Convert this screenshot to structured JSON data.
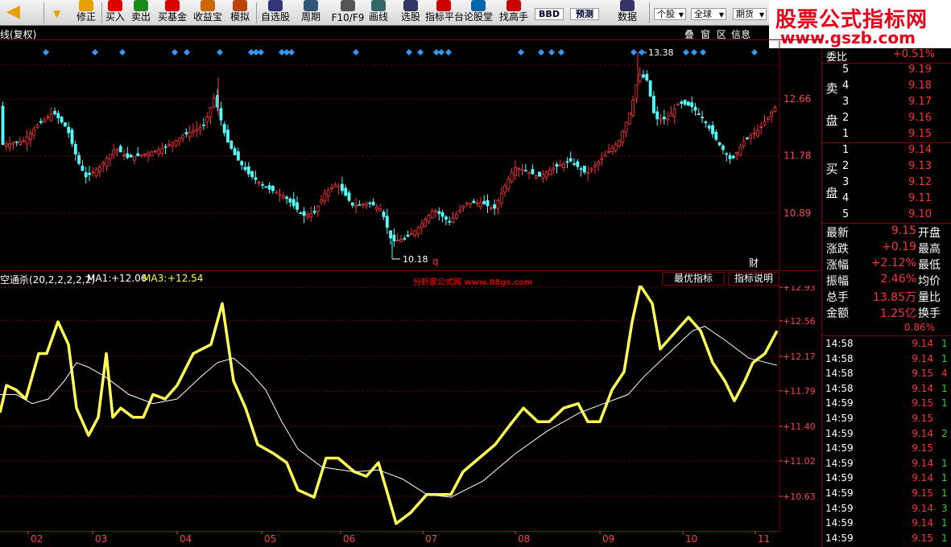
{
  "toolbar": {
    "buttons": [
      "修正",
      "买入",
      "卖出",
      "买基金",
      "收益宝",
      "模拟",
      "自选股",
      "周期",
      "F10/F9",
      "画线",
      "选股",
      "指标平台",
      "论股堂",
      "找高手",
      "数据"
    ],
    "badges": [
      "BBD",
      "预测"
    ],
    "dropdowns": [
      "个股",
      "全球",
      "期货"
    ]
  },
  "watermark": {
    "line1": "股票公式指标网",
    "line2": "www.gszb.com"
  },
  "chart": {
    "title": "线(复权)",
    "header_icons": [
      "叠",
      "窗",
      "区",
      "信息"
    ],
    "price_high_label": "13.38",
    "price_low_label": "10.18",
    "marker_q": "q",
    "marker_cai": "财",
    "price_axis": [
      "12.66",
      "11.78",
      "10.89"
    ]
  },
  "indicator": {
    "name": "空通杀(20,2,2,2,2,2)",
    "ma1_label": "MA1:",
    "ma1_value": "+12.06",
    "ma3_label": "MA3:",
    "ma3_value": "+12.54",
    "watermark_text": "分析家公式网 www.88gs.com",
    "buttons": [
      "最优指标",
      "指标说明"
    ],
    "axis": [
      "+12.93",
      "+12.56",
      "+12.17",
      "+11.79",
      "+11.40",
      "+11.02",
      "+10.63"
    ],
    "months": [
      "02",
      "03",
      "04",
      "05",
      "06",
      "07",
      "08",
      "09",
      "10",
      "11"
    ]
  },
  "quote": {
    "weibi_label": "委比",
    "weibi_value": "+0.51%",
    "sell_label": [
      "卖",
      "盘"
    ],
    "buy_label": [
      "买",
      "盘"
    ],
    "sell": [
      {
        "level": "5",
        "price": "9.19"
      },
      {
        "level": "4",
        "price": "9.18"
      },
      {
        "level": "3",
        "price": "9.17"
      },
      {
        "level": "2",
        "price": "9.16"
      },
      {
        "level": "1",
        "price": "9.15"
      }
    ],
    "buy": [
      {
        "level": "1",
        "price": "9.14"
      },
      {
        "level": "2",
        "price": "9.13"
      },
      {
        "level": "3",
        "price": "9.12"
      },
      {
        "level": "4",
        "price": "9.11"
      },
      {
        "level": "5",
        "price": "9.10"
      }
    ],
    "stats": [
      {
        "label": "最新",
        "value": "9.15",
        "right": "开盘"
      },
      {
        "label": "涨跌",
        "value": "+0.19",
        "right": "最高"
      },
      {
        "label": "涨幅",
        "value": "+2.12%",
        "right": "最低"
      },
      {
        "label": "振幅",
        "value": "2.46%",
        "right": "均价"
      },
      {
        "label": "总手",
        "value": "13.85万",
        "right": "量比"
      },
      {
        "label": "金额",
        "value": "1.25亿",
        "right": "换手"
      }
    ],
    "turnover_value": "0.86%",
    "ticks": [
      {
        "time": "14:58",
        "price": "9.14",
        "vol": "1"
      },
      {
        "time": "14:58",
        "price": "9.14",
        "vol": "1"
      },
      {
        "time": "14:58",
        "price": "9.15",
        "vol": "4"
      },
      {
        "time": "14:58",
        "price": "9.14",
        "vol": "1"
      },
      {
        "time": "14:59",
        "price": "9.15",
        "vol": "1"
      },
      {
        "time": "14:59",
        "price": "9.15",
        "vol": ""
      },
      {
        "time": "14:59",
        "price": "9.14",
        "vol": "2"
      },
      {
        "time": "14:59",
        "price": "9.15",
        "vol": ""
      },
      {
        "time": "14:59",
        "price": "9.14",
        "vol": "1"
      },
      {
        "time": "14:59",
        "price": "9.14",
        "vol": "1"
      },
      {
        "time": "14:59",
        "price": "9.15",
        "vol": "1"
      },
      {
        "time": "14:59",
        "price": "9.14",
        "vol": "3"
      },
      {
        "time": "14:59",
        "price": "9.14",
        "vol": "1"
      },
      {
        "time": "14:59",
        "price": "9.15",
        "vol": "1"
      }
    ]
  },
  "colors": {
    "up": "#ff3333",
    "down": "#54ffff",
    "indicator_line": "#ffff54",
    "ma_line": "#ffffff",
    "grid": "#800000",
    "diamond": "#3399ff"
  }
}
